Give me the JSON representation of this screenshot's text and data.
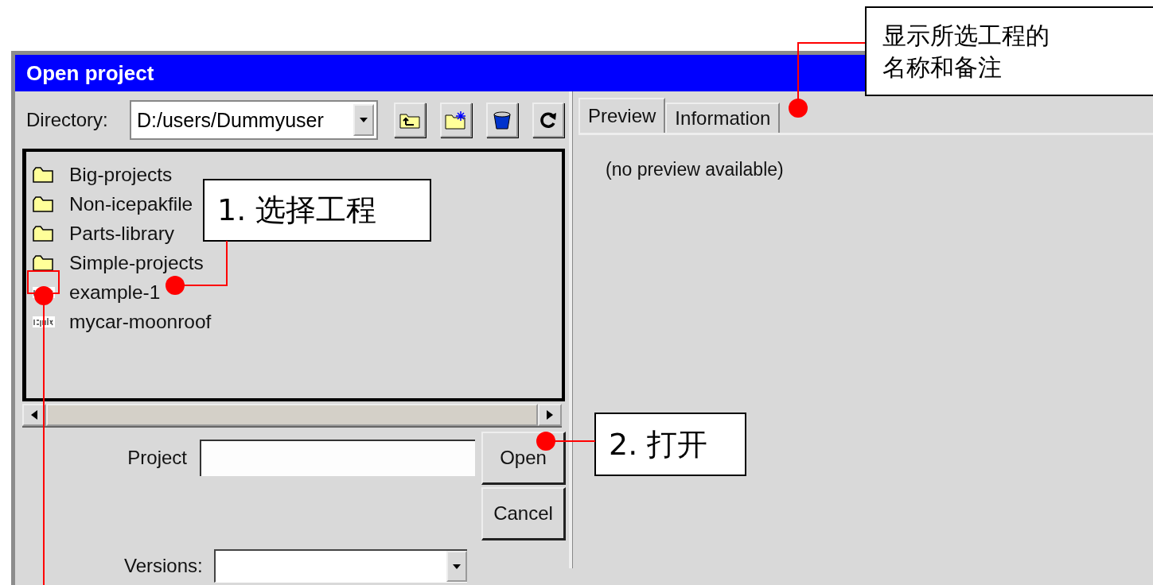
{
  "window": {
    "title": "Open project"
  },
  "directory": {
    "label": "Directory:",
    "value": "D:/users/Dummyuser"
  },
  "tree": [
    {
      "label": "Big-projects",
      "kind": "folder"
    },
    {
      "label": "Non-icepakfile",
      "kind": "folder"
    },
    {
      "label": "Parts-library",
      "kind": "folder"
    },
    {
      "label": "Simple-projects",
      "kind": "folder"
    },
    {
      "label": "example-1",
      "kind": "project"
    },
    {
      "label": "mycar-moonroof",
      "kind": "project"
    }
  ],
  "project": {
    "label": "Project"
  },
  "buttons": [
    "Open",
    "Cancel"
  ],
  "versions": {
    "label": "Versions:"
  },
  "tabs": [
    {
      "label": "Preview",
      "selected": true
    },
    {
      "label": "Information",
      "selected": false
    }
  ],
  "preview": {
    "text": "(no preview available)"
  },
  "callouts": [
    "1. 选择工程",
    "2. 打开",
    "显示所选工程的名称和备注"
  ]
}
